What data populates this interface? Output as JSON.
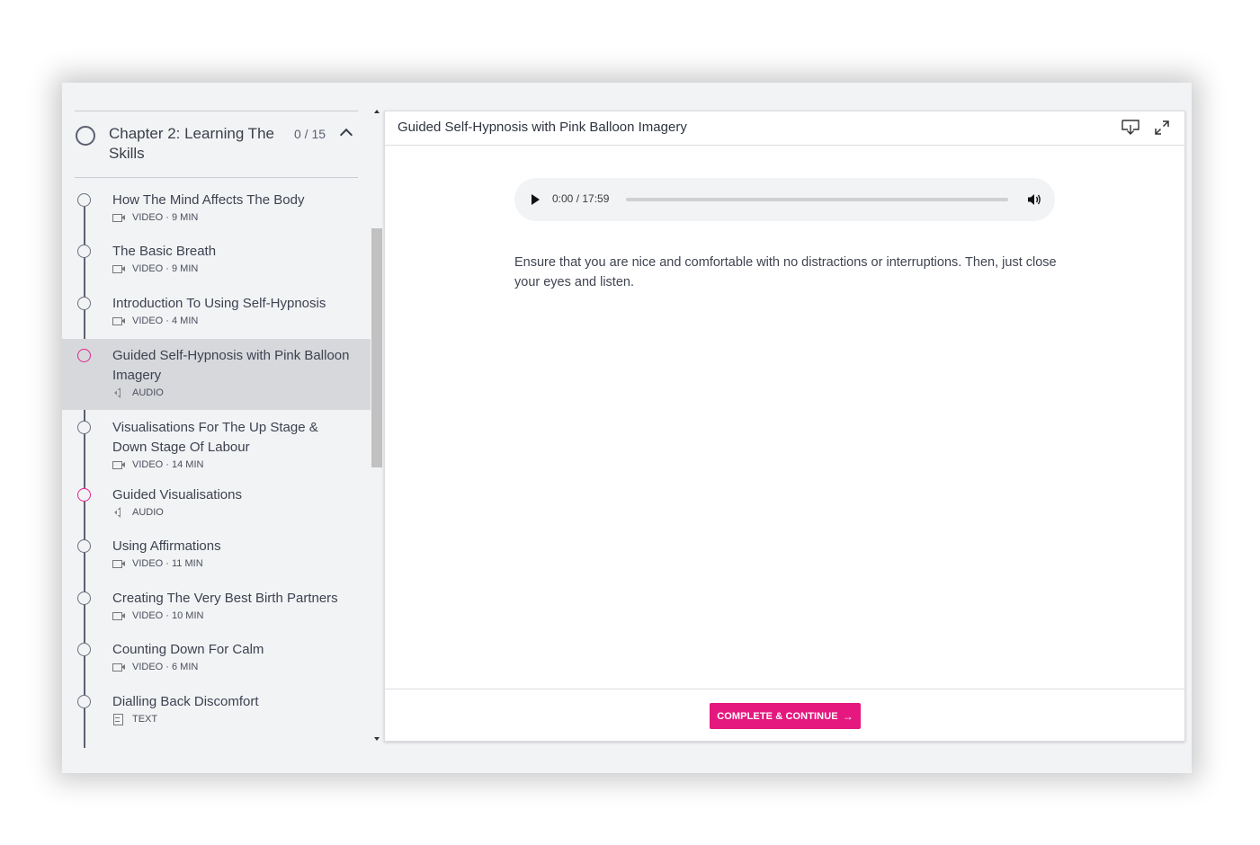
{
  "chapter": {
    "title": "Chapter 2: Learning The Skills",
    "progress": "0 / 15"
  },
  "lessons": [
    {
      "title": "How The Mind Affects The Body",
      "type": "video",
      "meta": "VIDEO · 9 MIN"
    },
    {
      "title": "The Basic Breath",
      "type": "video",
      "meta": "VIDEO · 9 MIN"
    },
    {
      "title": "Introduction To Using Self-Hypnosis",
      "type": "video",
      "meta": "VIDEO · 4 MIN"
    },
    {
      "title": "Guided Self-Hypnosis with Pink Balloon Imagery",
      "type": "audio",
      "meta": "AUDIO",
      "active": true
    },
    {
      "title": "Visualisations For The Up Stage & Down Stage Of Labour",
      "type": "video",
      "meta": "VIDEO · 14 MIN"
    },
    {
      "title": "Guided Visualisations",
      "type": "audio",
      "meta": "AUDIO"
    },
    {
      "title": "Using Affirmations",
      "type": "video",
      "meta": "VIDEO · 11 MIN"
    },
    {
      "title": "Creating The Very Best Birth Partners",
      "type": "video",
      "meta": "VIDEO · 10 MIN"
    },
    {
      "title": "Counting Down For Calm",
      "type": "video",
      "meta": "VIDEO · 6 MIN"
    },
    {
      "title": "Dialling Back Discomfort",
      "type": "text",
      "meta": "TEXT"
    }
  ],
  "content": {
    "title": "Guided Self-Hypnosis with Pink Balloon Imagery",
    "description": "Ensure that you are nice and comfortable with no distractions or interruptions. Then, just close your eyes and listen."
  },
  "player": {
    "time": "0:00 / 17:59",
    "progress_fraction": 0
  },
  "footer": {
    "complete_label": "COMPLETE & CONTINUE",
    "arrow": "→"
  },
  "colors": {
    "accent": "#e5187f",
    "audio_dot": "#e0288a",
    "sidebar_bg": "#f2f3f5",
    "active_lesson_bg": "#d6d8dc"
  },
  "icons": {
    "download": "download-icon",
    "expand": "expand-icon",
    "play": "play-icon",
    "volume": "volume-icon",
    "collapse": "chevron-up-icon"
  }
}
